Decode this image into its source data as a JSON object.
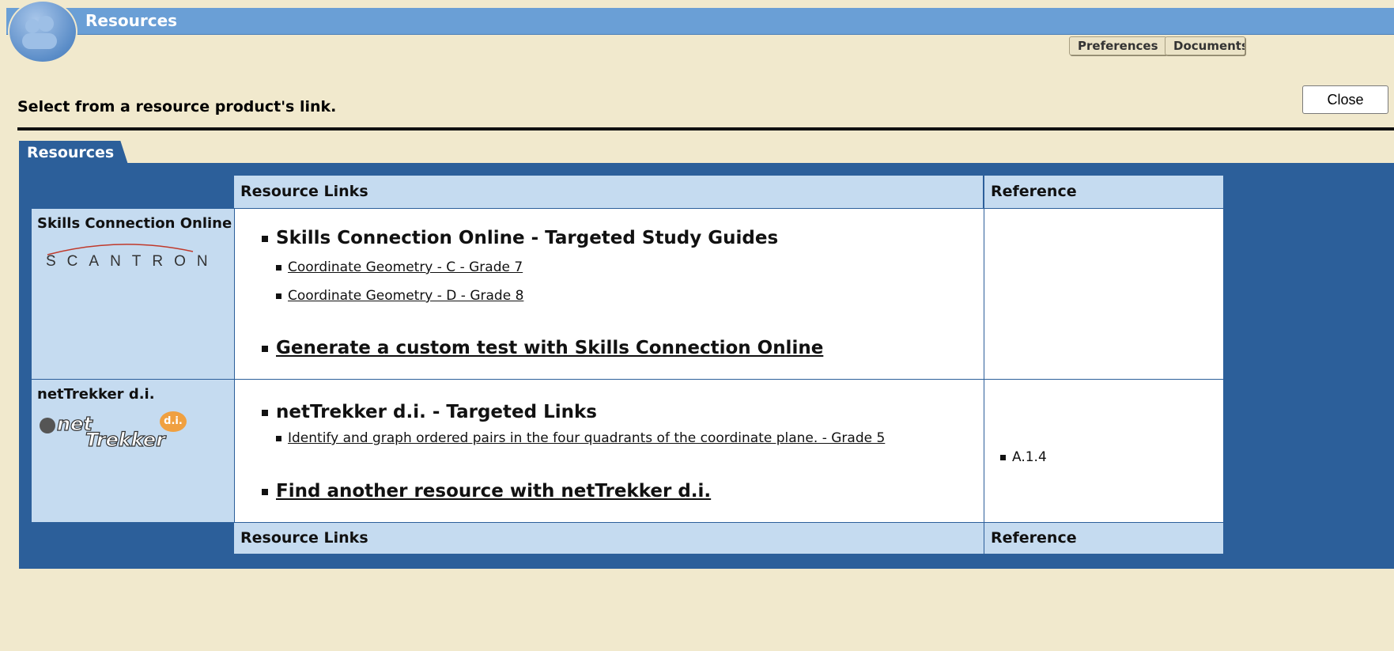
{
  "window": {
    "title": "Resources"
  },
  "top_buttons": {
    "preferences": "Preferences",
    "documents": "Documents"
  },
  "instruction": "Select from a resource product's link.",
  "close_label": "Close",
  "tab_label": "Resources",
  "table": {
    "header_links": "Resource Links",
    "header_reference": "Reference",
    "footer_links": "Resource Links",
    "footer_reference": "Reference",
    "rows": [
      {
        "product": "Skills Connection Online",
        "logo_text": "SCANTRON",
        "section_title": "Skills Connection Online - Targeted Study Guides",
        "links": [
          "Coordinate Geometry - C - Grade 7",
          "Coordinate Geometry - D - Grade 8"
        ],
        "action": "Generate a custom test with Skills Connection Online",
        "reference": ""
      },
      {
        "product": "netTrekker d.i.",
        "logo_text_1": "net",
        "logo_text_2": "Trekker",
        "logo_badge": "d.i.",
        "section_title": "netTrekker d.i. - Targeted Links",
        "links": [
          "Identify and graph ordered pairs in the four quadrants of the coordinate plane. - Grade 5"
        ],
        "action": "Find another resource with netTrekker d.i.",
        "reference": "A.1.4"
      }
    ]
  },
  "colors": {
    "background": "#f1e9cd",
    "titlebar": "#6a9fd6",
    "panel": "#2c5f9a",
    "header_cell": "#c5dbf0"
  },
  "icons": [
    "users-icon"
  ]
}
